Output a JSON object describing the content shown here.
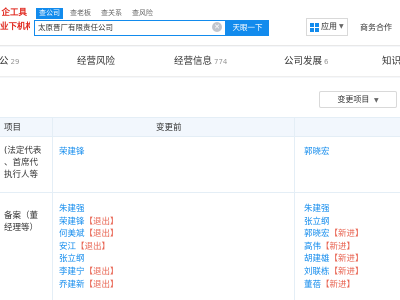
{
  "logo": {
    "line1": "企工具",
    "line2": "业下机构"
  },
  "search": {
    "tabs": [
      "查公司",
      "查老板",
      "查关系",
      "查风险"
    ],
    "value": "太原晋厂有限责任公司",
    "button": "天眼一下"
  },
  "header": {
    "app_label": "应用",
    "biz_label": "商务合作"
  },
  "nav": {
    "tabs": [
      {
        "label": "公",
        "count": "29"
      },
      {
        "label": "经营风险",
        "count": ""
      },
      {
        "label": "经营信息",
        "count": "774"
      },
      {
        "label": "公司发展",
        "count": "6"
      },
      {
        "label": "知识",
        "count": ""
      }
    ]
  },
  "changes": {
    "filter_button": "变更项目",
    "columns": {
      "item": "项目",
      "before": "变更前"
    },
    "rows": [
      {
        "label_lines": [
          "(法定代表",
          "、首席代",
          "执行人等"
        ],
        "before": [
          {
            "name": "荣建锋",
            "tag": ""
          }
        ],
        "after": [
          {
            "name": "郭晓宏",
            "tag": ""
          }
        ]
      },
      {
        "label_lines": [
          "备案（董",
          "经理等）"
        ],
        "before": [
          {
            "name": "朱建强",
            "tag": ""
          },
          {
            "name": "荣建锋",
            "tag": "【退出】"
          },
          {
            "name": "何美斌",
            "tag": "【退出】"
          },
          {
            "name": "安江",
            "tag": "【退出】"
          },
          {
            "name": "张立纲",
            "tag": ""
          },
          {
            "name": "李建宁",
            "tag": "【退出】"
          },
          {
            "name": "乔建新",
            "tag": "【退出】"
          }
        ],
        "after": [
          {
            "name": "朱建强",
            "tag": ""
          },
          {
            "name": "张立纲",
            "tag": ""
          },
          {
            "name": "郭晓宏",
            "tag": "【新进】"
          },
          {
            "name": "高伟",
            "tag": "【新进】"
          },
          {
            "name": "胡建雄",
            "tag": "【新进】"
          },
          {
            "name": "刘联栋",
            "tag": "【新进】"
          },
          {
            "name": "董蓓",
            "tag": "【新进】"
          }
        ]
      }
    ]
  }
}
